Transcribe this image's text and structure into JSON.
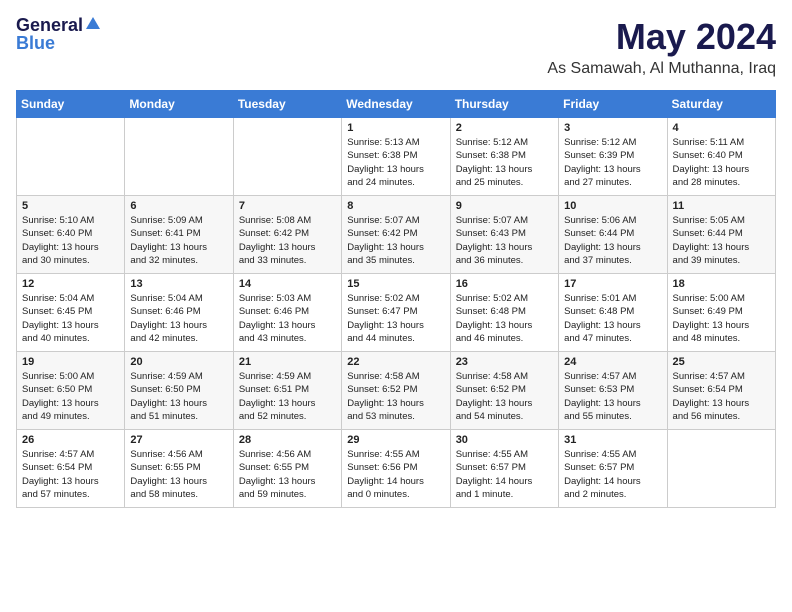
{
  "logo": {
    "general": "General",
    "blue": "Blue"
  },
  "title": "May 2024",
  "location": "As Samawah, Al Muthanna, Iraq",
  "headers": [
    "Sunday",
    "Monday",
    "Tuesday",
    "Wednesday",
    "Thursday",
    "Friday",
    "Saturday"
  ],
  "weeks": [
    [
      {
        "day": "",
        "info": ""
      },
      {
        "day": "",
        "info": ""
      },
      {
        "day": "",
        "info": ""
      },
      {
        "day": "1",
        "info": "Sunrise: 5:13 AM\nSunset: 6:38 PM\nDaylight: 13 hours\nand 24 minutes."
      },
      {
        "day": "2",
        "info": "Sunrise: 5:12 AM\nSunset: 6:38 PM\nDaylight: 13 hours\nand 25 minutes."
      },
      {
        "day": "3",
        "info": "Sunrise: 5:12 AM\nSunset: 6:39 PM\nDaylight: 13 hours\nand 27 minutes."
      },
      {
        "day": "4",
        "info": "Sunrise: 5:11 AM\nSunset: 6:40 PM\nDaylight: 13 hours\nand 28 minutes."
      }
    ],
    [
      {
        "day": "5",
        "info": "Sunrise: 5:10 AM\nSunset: 6:40 PM\nDaylight: 13 hours\nand 30 minutes."
      },
      {
        "day": "6",
        "info": "Sunrise: 5:09 AM\nSunset: 6:41 PM\nDaylight: 13 hours\nand 32 minutes."
      },
      {
        "day": "7",
        "info": "Sunrise: 5:08 AM\nSunset: 6:42 PM\nDaylight: 13 hours\nand 33 minutes."
      },
      {
        "day": "8",
        "info": "Sunrise: 5:07 AM\nSunset: 6:42 PM\nDaylight: 13 hours\nand 35 minutes."
      },
      {
        "day": "9",
        "info": "Sunrise: 5:07 AM\nSunset: 6:43 PM\nDaylight: 13 hours\nand 36 minutes."
      },
      {
        "day": "10",
        "info": "Sunrise: 5:06 AM\nSunset: 6:44 PM\nDaylight: 13 hours\nand 37 minutes."
      },
      {
        "day": "11",
        "info": "Sunrise: 5:05 AM\nSunset: 6:44 PM\nDaylight: 13 hours\nand 39 minutes."
      }
    ],
    [
      {
        "day": "12",
        "info": "Sunrise: 5:04 AM\nSunset: 6:45 PM\nDaylight: 13 hours\nand 40 minutes."
      },
      {
        "day": "13",
        "info": "Sunrise: 5:04 AM\nSunset: 6:46 PM\nDaylight: 13 hours\nand 42 minutes."
      },
      {
        "day": "14",
        "info": "Sunrise: 5:03 AM\nSunset: 6:46 PM\nDaylight: 13 hours\nand 43 minutes."
      },
      {
        "day": "15",
        "info": "Sunrise: 5:02 AM\nSunset: 6:47 PM\nDaylight: 13 hours\nand 44 minutes."
      },
      {
        "day": "16",
        "info": "Sunrise: 5:02 AM\nSunset: 6:48 PM\nDaylight: 13 hours\nand 46 minutes."
      },
      {
        "day": "17",
        "info": "Sunrise: 5:01 AM\nSunset: 6:48 PM\nDaylight: 13 hours\nand 47 minutes."
      },
      {
        "day": "18",
        "info": "Sunrise: 5:00 AM\nSunset: 6:49 PM\nDaylight: 13 hours\nand 48 minutes."
      }
    ],
    [
      {
        "day": "19",
        "info": "Sunrise: 5:00 AM\nSunset: 6:50 PM\nDaylight: 13 hours\nand 49 minutes."
      },
      {
        "day": "20",
        "info": "Sunrise: 4:59 AM\nSunset: 6:50 PM\nDaylight: 13 hours\nand 51 minutes."
      },
      {
        "day": "21",
        "info": "Sunrise: 4:59 AM\nSunset: 6:51 PM\nDaylight: 13 hours\nand 52 minutes."
      },
      {
        "day": "22",
        "info": "Sunrise: 4:58 AM\nSunset: 6:52 PM\nDaylight: 13 hours\nand 53 minutes."
      },
      {
        "day": "23",
        "info": "Sunrise: 4:58 AM\nSunset: 6:52 PM\nDaylight: 13 hours\nand 54 minutes."
      },
      {
        "day": "24",
        "info": "Sunrise: 4:57 AM\nSunset: 6:53 PM\nDaylight: 13 hours\nand 55 minutes."
      },
      {
        "day": "25",
        "info": "Sunrise: 4:57 AM\nSunset: 6:54 PM\nDaylight: 13 hours\nand 56 minutes."
      }
    ],
    [
      {
        "day": "26",
        "info": "Sunrise: 4:57 AM\nSunset: 6:54 PM\nDaylight: 13 hours\nand 57 minutes."
      },
      {
        "day": "27",
        "info": "Sunrise: 4:56 AM\nSunset: 6:55 PM\nDaylight: 13 hours\nand 58 minutes."
      },
      {
        "day": "28",
        "info": "Sunrise: 4:56 AM\nSunset: 6:55 PM\nDaylight: 13 hours\nand 59 minutes."
      },
      {
        "day": "29",
        "info": "Sunrise: 4:55 AM\nSunset: 6:56 PM\nDaylight: 14 hours\nand 0 minutes."
      },
      {
        "day": "30",
        "info": "Sunrise: 4:55 AM\nSunset: 6:57 PM\nDaylight: 14 hours\nand 1 minute."
      },
      {
        "day": "31",
        "info": "Sunrise: 4:55 AM\nSunset: 6:57 PM\nDaylight: 14 hours\nand 2 minutes."
      },
      {
        "day": "",
        "info": ""
      }
    ]
  ]
}
